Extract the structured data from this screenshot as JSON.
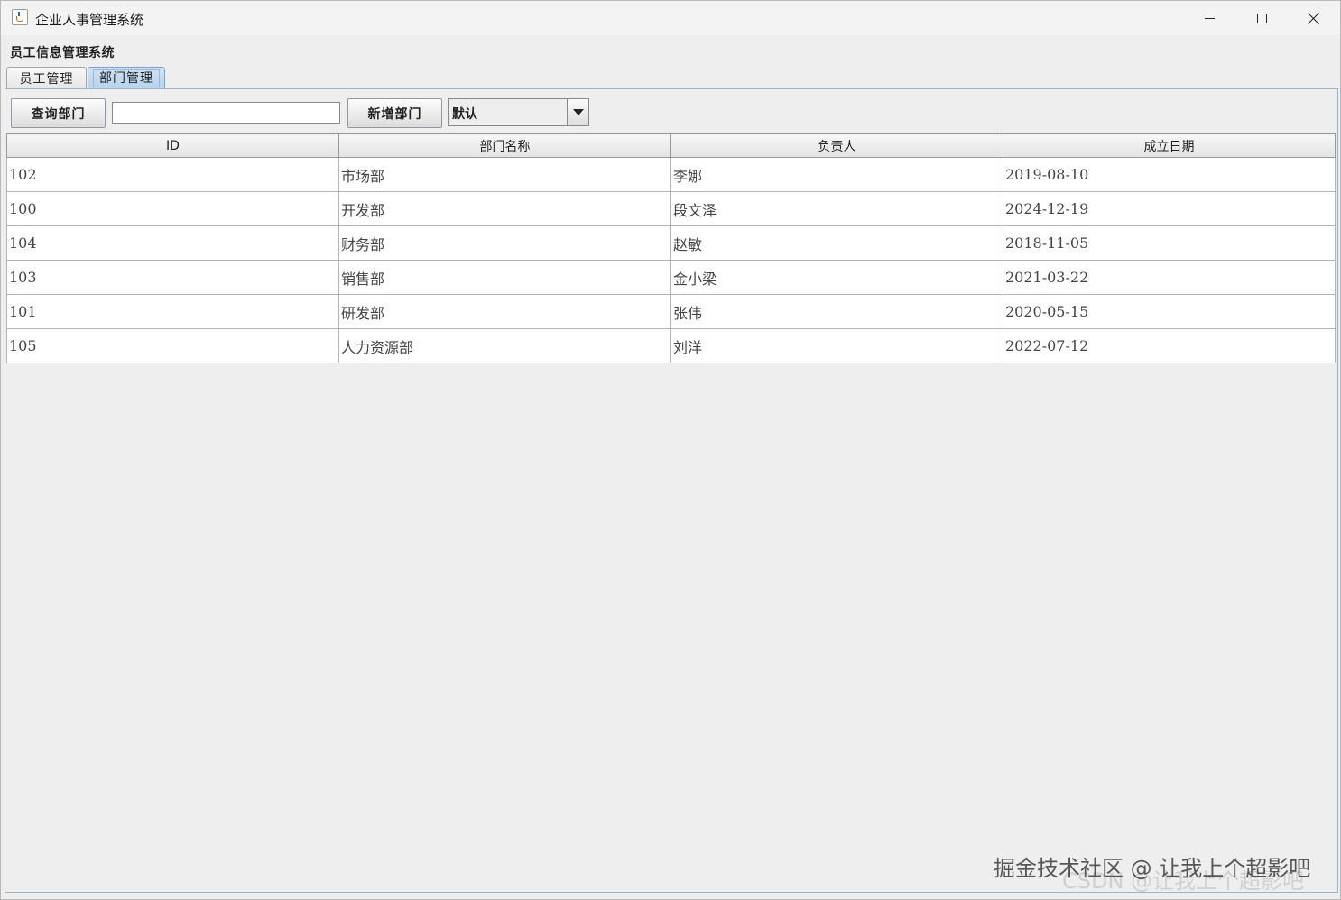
{
  "window": {
    "title": "企业人事管理系统",
    "controls": {
      "minimize": "minimize",
      "maximize": "maximize",
      "close": "close"
    }
  },
  "app": {
    "header": "员工信息管理系统"
  },
  "tabs": [
    {
      "label": "员工管理",
      "selected": false
    },
    {
      "label": "部门管理",
      "selected": true
    }
  ],
  "toolbar": {
    "query_label": "查询部门",
    "search_value": "",
    "add_label": "新增部门",
    "sort_selected": "默认"
  },
  "table": {
    "columns": [
      "ID",
      "部门名称",
      "负责人",
      "成立日期"
    ],
    "rows": [
      [
        "102",
        "市场部",
        "李娜",
        "2019-08-10"
      ],
      [
        "100",
        "开发部",
        "段文泽",
        "2024-12-19"
      ],
      [
        "104",
        "财务部",
        "赵敏",
        "2018-11-05"
      ],
      [
        "103",
        "销售部",
        "金小梁",
        "2021-03-22"
      ],
      [
        "101",
        "研发部",
        "张伟",
        "2020-05-15"
      ],
      [
        "105",
        "人力资源部",
        "刘洋",
        "2022-07-12"
      ]
    ]
  },
  "watermark": {
    "line1": "掘金技术社区 @ 让我上个超影吧",
    "line2": "CSDN @让我上个超影吧"
  },
  "colors": {
    "window_bg": "#eeeeee",
    "selected_tab": "#b8d3ee",
    "table_bg": "#ffffff"
  }
}
